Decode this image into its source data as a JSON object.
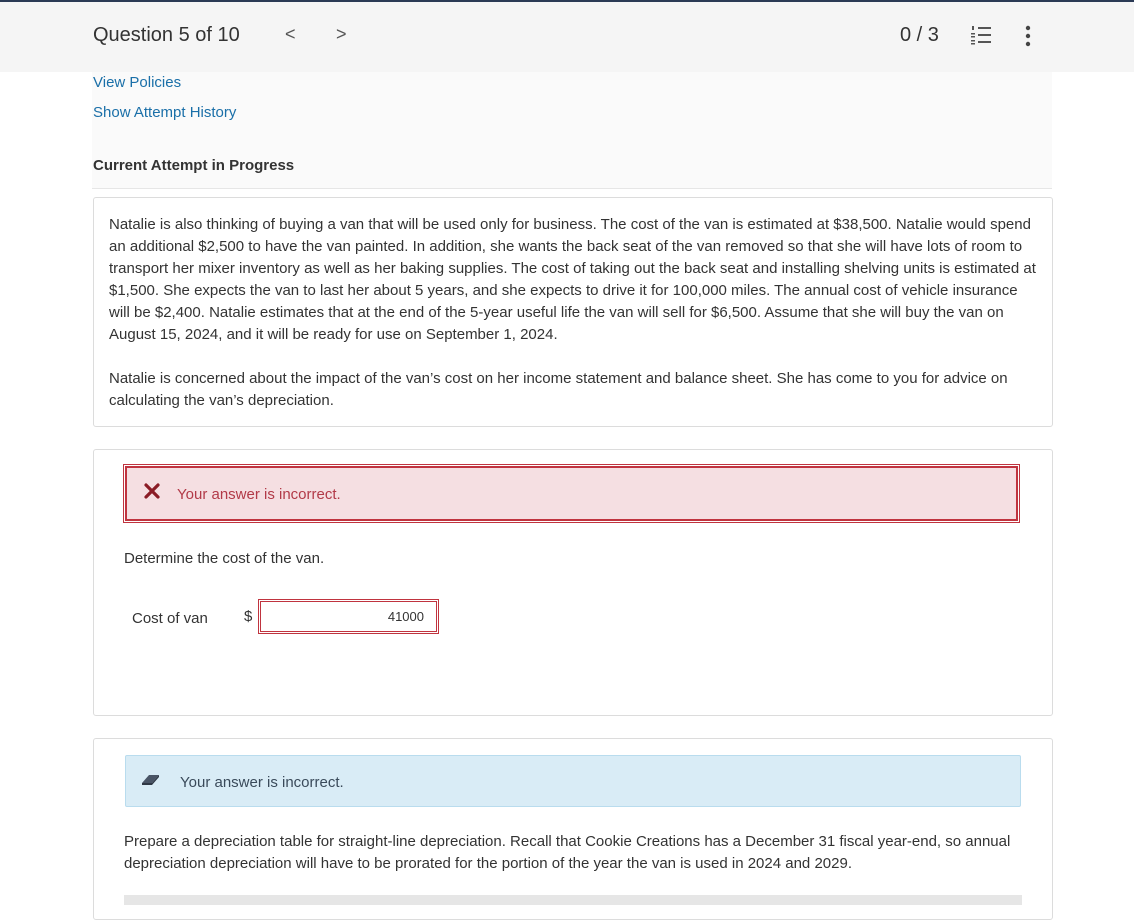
{
  "header": {
    "question_label": "Question 5 of 10",
    "prev_glyph": "<",
    "next_glyph": ">",
    "score": "0 / 3",
    "list_icon": "numbered-list-icon",
    "more_icon": "more-vertical-icon"
  },
  "sidebar": {
    "view_policies": "View Policies",
    "show_attempt_history": "Show Attempt History",
    "attempt_status": "Current Attempt in Progress"
  },
  "problem": {
    "paragraph1": "Natalie is also thinking of buying a van that will be used only for business. The cost of the van is estimated at $38,500. Natalie would spend an additional $2,500 to have the van painted. In addition, she wants the back seat of the van removed so that she will have lots of room to transport her mixer inventory as well as her baking supplies. The cost of taking out the back seat and installing shelving units is estimated at $1,500. She expects the van to last her about 5 years, and she expects to drive it for 100,000 miles. The annual cost of vehicle insurance will be $2,400. Natalie estimates that at the end of the 5-year useful life the van will sell for $6,500. Assume that she will buy the van on August 15, 2024, and it will be ready for use on September 1, 2024.",
    "paragraph2": "Natalie is concerned about the impact of the van’s cost on her income statement and balance sheet. She has come to you for advice on calculating the van’s depreciation."
  },
  "part1": {
    "feedback": "Your answer is incorrect.",
    "feedback_icon": "x-mark-icon",
    "prompt": "Determine the cost of the van.",
    "field_label": "Cost of van",
    "currency": "$",
    "answer_value": "41000"
  },
  "part2": {
    "feedback": "Your answer is incorrect.",
    "feedback_icon": "eraser-icon",
    "prompt": "Prepare a depreciation table for straight-line depreciation. Recall that Cookie Creations has a December 31 fiscal year-end, so annual depreciation depreciation will have to be prorated for the portion of the year the van is used in 2024 and 2029."
  },
  "colors": {
    "link": "#1a6fa8",
    "error_border": "#c0343f",
    "error_bg": "#f5dfe2",
    "error_text": "#b23a48",
    "info_bg": "#d9ecf6"
  }
}
